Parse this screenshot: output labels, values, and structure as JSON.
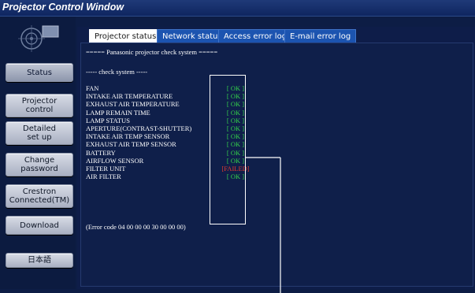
{
  "window": {
    "title": "Projector Control Window"
  },
  "sidebar": {
    "logo_icon": "projector-lens-icon",
    "items": [
      {
        "name": "nav-status",
        "line1": "Status",
        "line2": "",
        "active": true
      },
      {
        "name": "nav-projector-control",
        "line1": "Projector",
        "line2": "control",
        "active": false
      },
      {
        "name": "nav-detailed-setup",
        "line1": "Detailed",
        "line2": "set up",
        "active": false
      },
      {
        "name": "nav-change-password",
        "line1": "Change",
        "line2": "password",
        "active": false
      },
      {
        "name": "nav-crestron",
        "line1": "Crestron",
        "line2": "Connected(TM)",
        "active": false
      },
      {
        "name": "nav-download",
        "line1": "Download",
        "line2": "",
        "active": false
      },
      {
        "name": "nav-language",
        "line1": "日本語",
        "line2": "",
        "active": false
      }
    ]
  },
  "tabs": [
    {
      "label": "Projector status",
      "active": true
    },
    {
      "label": "Network status",
      "active": false
    },
    {
      "label": "Access error log",
      "active": false
    },
    {
      "label": "E-mail error log",
      "active": false
    }
  ],
  "check": {
    "header": "===== Panasonic projector check system =====",
    "subheader": "----- check system -----",
    "items": [
      {
        "label": "FAN",
        "status": "[ OK ]",
        "state": "ok"
      },
      {
        "label": "INTAKE AIR TEMPERATURE",
        "status": "[ OK ]",
        "state": "ok"
      },
      {
        "label": "EXHAUST AIR TEMPERATURE",
        "status": "[ OK ]",
        "state": "ok"
      },
      {
        "label": "LAMP REMAIN TIME",
        "status": "[ OK ]",
        "state": "ok"
      },
      {
        "label": "LAMP STATUS",
        "status": "[ OK ]",
        "state": "ok"
      },
      {
        "label": "APERTURE(CONTRAST-SHUTTER)",
        "status": "[ OK ]",
        "state": "ok"
      },
      {
        "label": "INTAKE AIR TEMP SENSOR",
        "status": "[ OK ]",
        "state": "ok"
      },
      {
        "label": "EXHAUST AIR TEMP SENSOR",
        "status": "[ OK ]",
        "state": "ok"
      },
      {
        "label": "BATTERY",
        "status": "[ OK ]",
        "state": "ok"
      },
      {
        "label": "AIRFLOW SENSOR",
        "status": "[ OK ]",
        "state": "ok"
      },
      {
        "label": "FILTER UNIT",
        "status": "[FAILED]",
        "state": "failed"
      },
      {
        "label": "AIR FILTER",
        "status": "[ OK ]",
        "state": "ok"
      }
    ],
    "error_code": "(Error code 04 00 00 00 30 00 00 00)"
  },
  "colors": {
    "ok": "#34d24a",
    "failed": "#e23a2e",
    "title_bar": "#1f3a78",
    "tab_blue": "#1c54b0",
    "panel_bg": "#0f1f4a"
  }
}
